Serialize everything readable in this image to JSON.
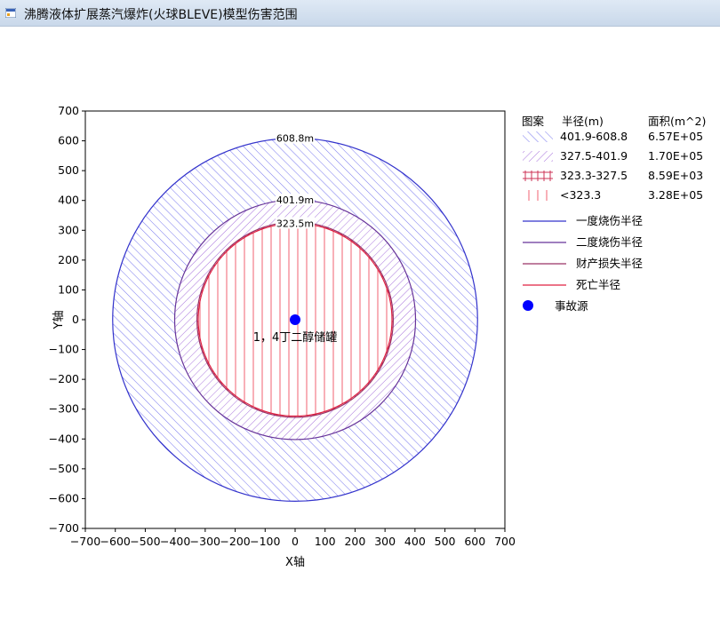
{
  "window": {
    "title": "沸腾液体扩展蒸汽爆炸(火球BLEVE)模型伤害范围"
  },
  "chart_data": {
    "type": "scatter",
    "xlabel": "X轴",
    "ylabel": "Y轴",
    "xlim": [
      -700,
      700
    ],
    "ylim": [
      -700,
      700
    ],
    "xticks": [
      -700,
      -600,
      -500,
      -400,
      -300,
      -200,
      -100,
      0,
      100,
      200,
      300,
      400,
      500,
      600,
      700
    ],
    "yticks": [
      700,
      600,
      500,
      400,
      300,
      200,
      100,
      0,
      -100,
      -200,
      -300,
      -400,
      -500,
      -600,
      -700
    ],
    "grid": false,
    "legend_placement": "right",
    "source": {
      "x": 0,
      "y": 0,
      "label": "1，4丁二醇储罐",
      "color": "#0000ff"
    },
    "circles": [
      {
        "radius": 608.8,
        "label": "608.8m",
        "color": "#3333cc"
      },
      {
        "radius": 401.9,
        "label": "401.9m",
        "color": "#663399"
      },
      {
        "radius": 327.5,
        "label": "",
        "color": "#993366"
      },
      {
        "radius": 323.3,
        "label": "323.5m",
        "color": "#e02040"
      }
    ],
    "bands": [
      {
        "outer": 608.8,
        "inner": 401.9,
        "pattern": "diag-fwd",
        "color": "#7777ee"
      },
      {
        "outer": 401.9,
        "inner": 327.5,
        "pattern": "diag-back",
        "color": "#aa77dd"
      },
      {
        "outer": 327.5,
        "inner": 323.3,
        "pattern": "cross",
        "color": "#cc3355"
      },
      {
        "outer": 323.3,
        "inner": 0,
        "pattern": "vertical",
        "color": "#f06070"
      }
    ]
  },
  "legend": {
    "header_pattern": "图案",
    "header_radius": "半径(m)",
    "header_area": "面积(m^2)",
    "patterns": [
      {
        "range": "401.9-608.8",
        "area": "6.57E+05",
        "pattern": "diag-fwd",
        "color": "#7777ee"
      },
      {
        "range": "327.5-401.9",
        "area": "1.70E+05",
        "pattern": "diag-back",
        "color": "#aa77dd"
      },
      {
        "range": "323.3-327.5",
        "area": "8.59E+03",
        "pattern": "cross",
        "color": "#cc3355"
      },
      {
        "range": "<323.3",
        "area": "3.28E+05",
        "pattern": "vertical",
        "color": "#f06070"
      }
    ],
    "lines": [
      {
        "label": "一度烧伤半径",
        "color": "#3333cc"
      },
      {
        "label": "二度烧伤半径",
        "color": "#663399"
      },
      {
        "label": "财产损失半径",
        "color": "#993366"
      },
      {
        "label": "死亡半径",
        "color": "#e02040"
      }
    ],
    "marker": {
      "label": "事故源",
      "color": "#0000ff"
    }
  }
}
